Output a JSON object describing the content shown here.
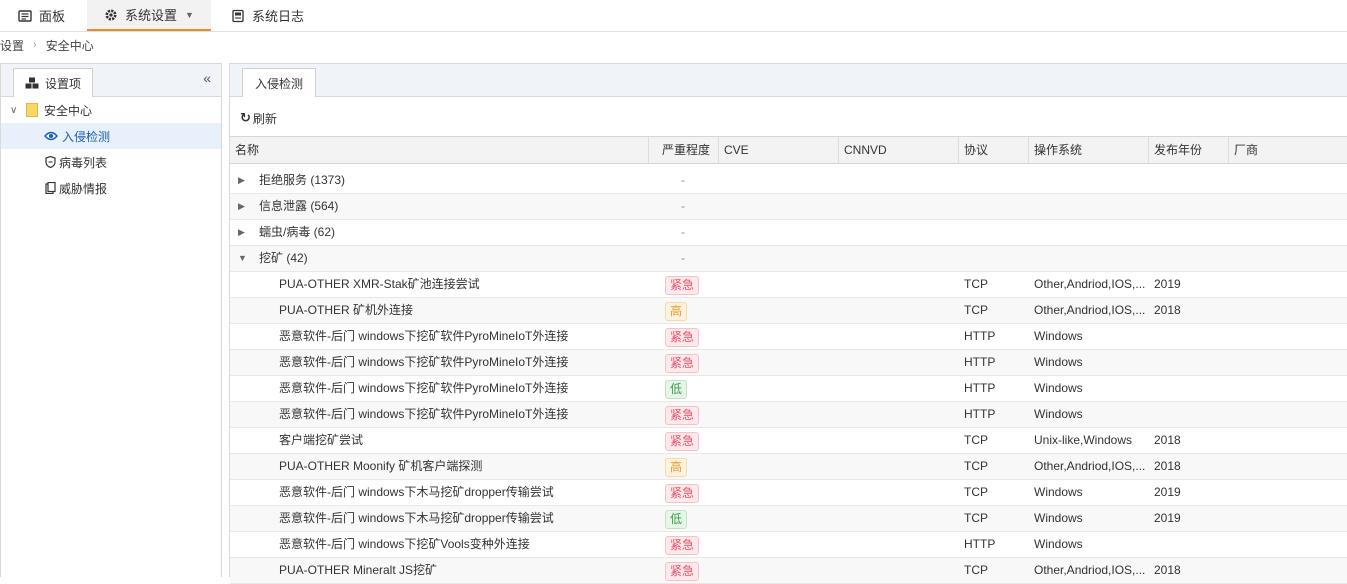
{
  "top_tabs": [
    {
      "label": "面板",
      "icon": "dashboard-icon"
    },
    {
      "label": "系统设置",
      "icon": "gear-icon",
      "active": true
    },
    {
      "label": "系统日志",
      "icon": "log-icon"
    }
  ],
  "breadcrumb": [
    "设置",
    "安全中心"
  ],
  "left_panel": {
    "tab_label": "设置项",
    "tree": [
      {
        "label": "安全中心",
        "icon": "folder-icon"
      },
      {
        "label": "入侵检测",
        "icon": "intrusion-eye-icon",
        "selected": true
      },
      {
        "label": "病毒列表",
        "icon": "virus-shield-icon"
      },
      {
        "label": "威胁情报",
        "icon": "intel-doc-icon"
      }
    ]
  },
  "right_panel": {
    "tab_label": "入侵检测",
    "refresh_label": "刷新",
    "columns": [
      "名称",
      "严重程度",
      "CVE",
      "CNNVD",
      "协议",
      "操作系统",
      "发布年份",
      "厂商"
    ],
    "groups": [
      {
        "name": "拒绝服务 (1373)",
        "severity": "-"
      },
      {
        "name": "信息泄露 (564)",
        "severity": "-"
      },
      {
        "name": "蠕虫/病毒 (62)",
        "severity": "-"
      },
      {
        "name": "挖矿 (42)",
        "severity": "-",
        "expanded": true
      }
    ],
    "rows": [
      {
        "name": "PUA-OTHER XMR-Stak矿池连接尝试",
        "severity": "紧急",
        "level": "urgent",
        "protocol": "TCP",
        "os": "Other,Andriod,IOS,...",
        "year": "2019"
      },
      {
        "name": "PUA-OTHER 矿机外连接",
        "severity": "高",
        "level": "high",
        "protocol": "TCP",
        "os": "Other,Andriod,IOS,...",
        "year": "2018"
      },
      {
        "name": "恶意软件-后门 windows下挖矿软件PyroMineIoT外连接",
        "severity": "紧急",
        "level": "urgent",
        "protocol": "HTTP",
        "os": "Windows",
        "year": ""
      },
      {
        "name": "恶意软件-后门 windows下挖矿软件PyroMineIoT外连接",
        "severity": "紧急",
        "level": "urgent",
        "protocol": "HTTP",
        "os": "Windows",
        "year": ""
      },
      {
        "name": "恶意软件-后门 windows下挖矿软件PyroMineIoT外连接",
        "severity": "低",
        "level": "low",
        "protocol": "HTTP",
        "os": "Windows",
        "year": ""
      },
      {
        "name": "恶意软件-后门 windows下挖矿软件PyroMineIoT外连接",
        "severity": "紧急",
        "level": "urgent",
        "protocol": "HTTP",
        "os": "Windows",
        "year": ""
      },
      {
        "name": "客户端挖矿尝试",
        "severity": "紧急",
        "level": "urgent",
        "protocol": "TCP",
        "os": "Unix-like,Windows",
        "year": "2018"
      },
      {
        "name": "PUA-OTHER Moonify 矿机客户端探测",
        "severity": "高",
        "level": "high",
        "protocol": "TCP",
        "os": "Other,Andriod,IOS,...",
        "year": "2018"
      },
      {
        "name": "恶意软件-后门 windows下木马挖矿dropper传输尝试",
        "severity": "紧急",
        "level": "urgent",
        "protocol": "TCP",
        "os": "Windows",
        "year": "2019"
      },
      {
        "name": "恶意软件-后门 windows下木马挖矿dropper传输尝试",
        "severity": "低",
        "level": "low",
        "protocol": "TCP",
        "os": "Windows",
        "year": "2019"
      },
      {
        "name": "恶意软件-后门 windows下挖矿Vools变种外连接",
        "severity": "紧急",
        "level": "urgent",
        "protocol": "HTTP",
        "os": "Windows",
        "year": ""
      },
      {
        "name": "PUA-OTHER Mineralt JS挖矿",
        "severity": "紧急",
        "level": "urgent",
        "protocol": "TCP",
        "os": "Other,Andriod,IOS,...",
        "year": "2018"
      }
    ]
  },
  "colors": {
    "accent": "#f08a24",
    "selected_bg": "#e8f0fb",
    "selected_text": "#1a5fb4",
    "urgent": "#e0556a",
    "high": "#e49a2a",
    "low": "#3a9e48"
  }
}
